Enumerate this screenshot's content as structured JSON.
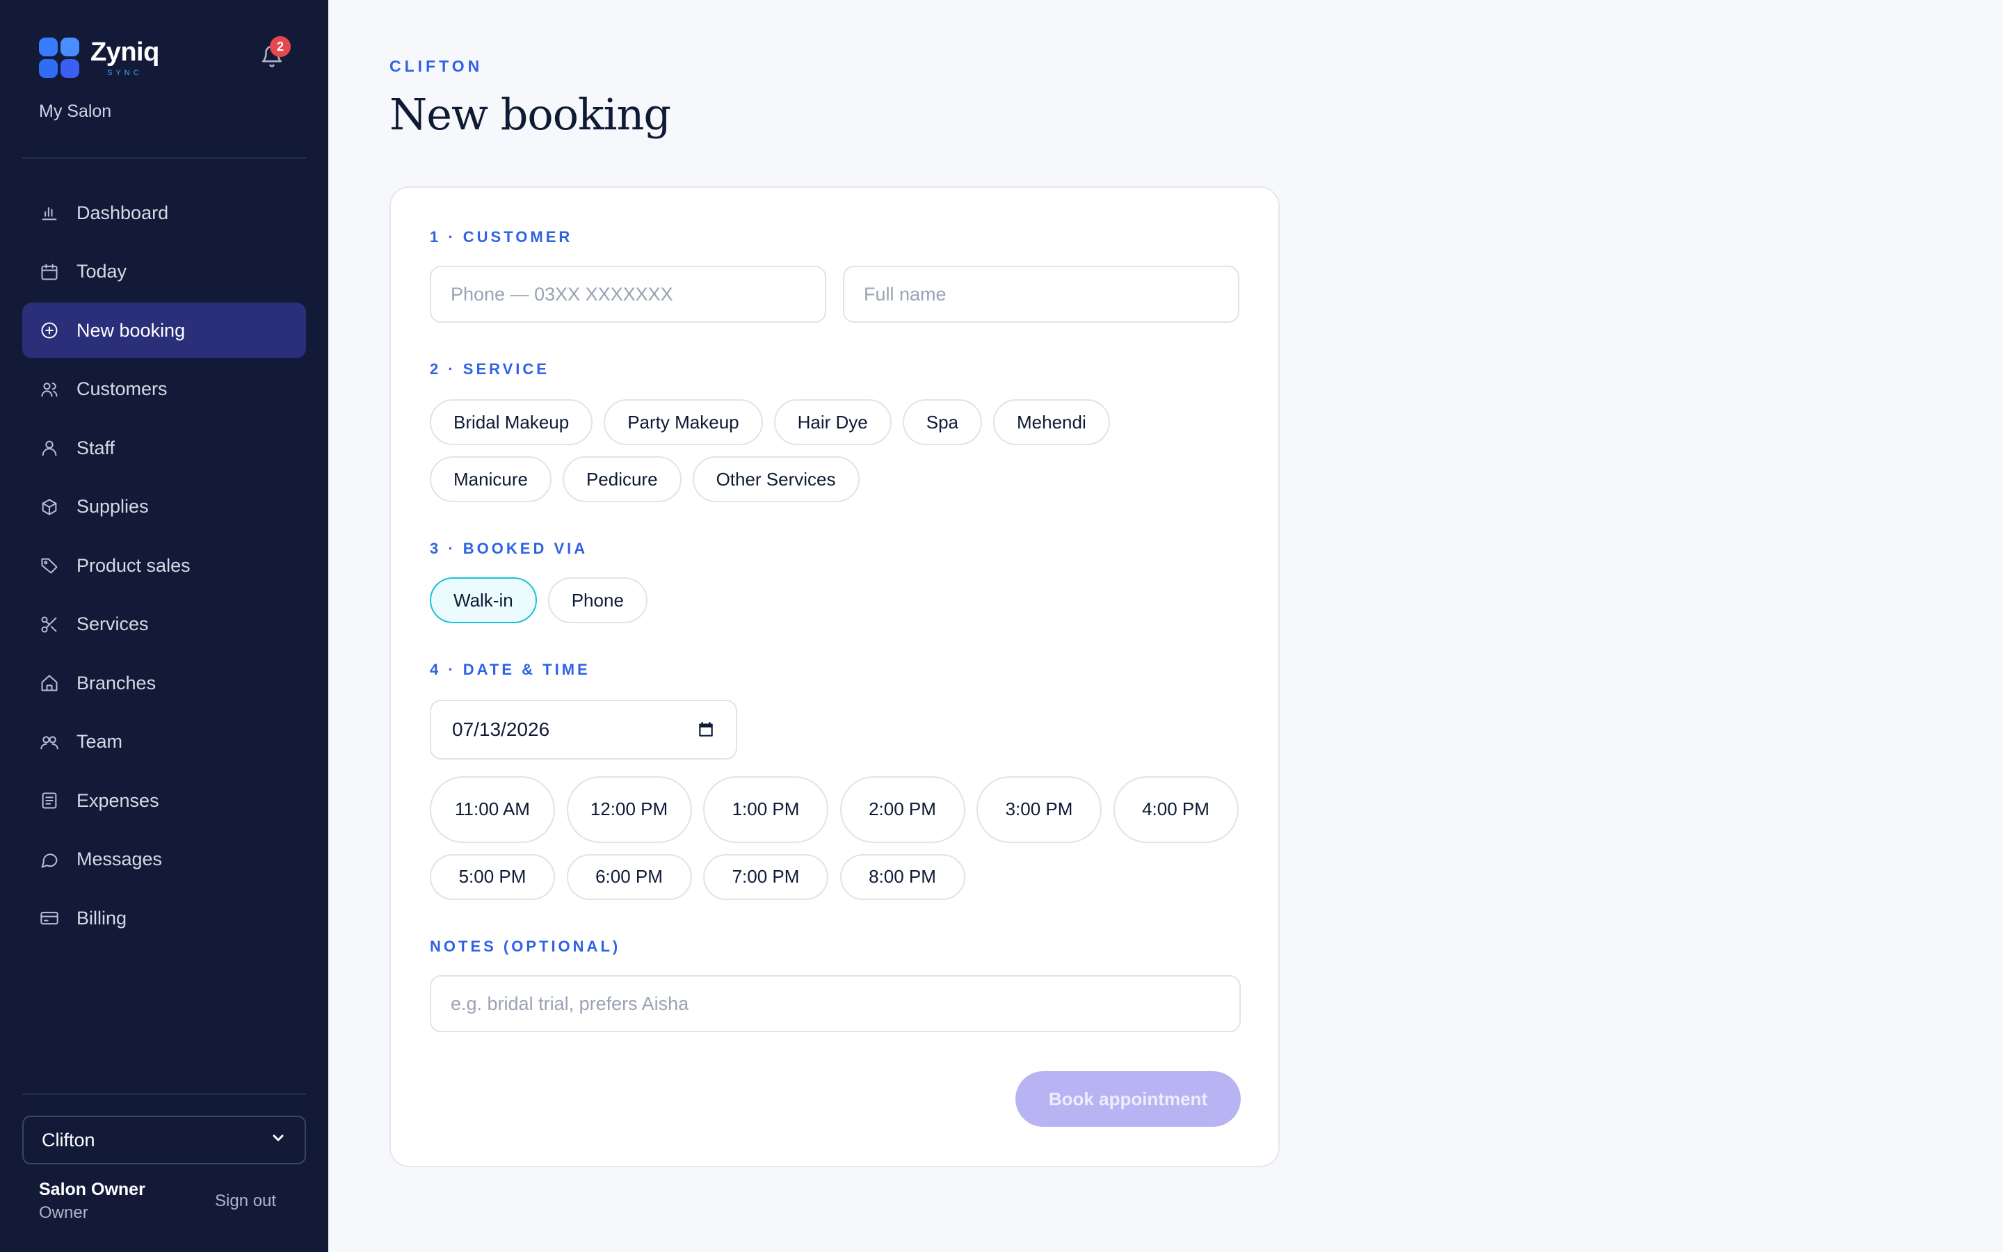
{
  "brand": {
    "name": "Zyniq",
    "sub": "SYNC",
    "salon": "My Salon",
    "notification_count": "2"
  },
  "nav": [
    {
      "label": "Dashboard",
      "icon": "bar-chart-icon",
      "active": false
    },
    {
      "label": "Today",
      "icon": "calendar-icon",
      "active": false
    },
    {
      "label": "New booking",
      "icon": "plus-circle-icon",
      "active": true
    },
    {
      "label": "Customers",
      "icon": "users-icon",
      "active": false
    },
    {
      "label": "Staff",
      "icon": "user-icon",
      "active": false
    },
    {
      "label": "Supplies",
      "icon": "box-icon",
      "active": false
    },
    {
      "label": "Product sales",
      "icon": "tag-icon",
      "active": false
    },
    {
      "label": "Services",
      "icon": "scissors-icon",
      "active": false
    },
    {
      "label": "Branches",
      "icon": "home-icon",
      "active": false
    },
    {
      "label": "Team",
      "icon": "team-icon",
      "active": false
    },
    {
      "label": "Expenses",
      "icon": "receipt-icon",
      "active": false
    },
    {
      "label": "Messages",
      "icon": "chat-icon",
      "active": false
    },
    {
      "label": "Billing",
      "icon": "credit-card-icon",
      "active": false
    }
  ],
  "branch_select": {
    "value": "Clifton"
  },
  "user": {
    "name": "Salon Owner",
    "role": "Owner",
    "signout": "Sign out"
  },
  "page": {
    "eyebrow": "CLIFTON",
    "title": "New booking"
  },
  "customer": {
    "label": "1 · CUSTOMER",
    "phone_placeholder": "Phone — 03XX XXXXXXX",
    "name_placeholder": "Full name"
  },
  "service": {
    "label": "2 · SERVICE",
    "options": [
      "Bridal Makeup",
      "Party Makeup",
      "Hair Dye",
      "Spa",
      "Mehendi",
      "Manicure",
      "Pedicure",
      "Other Services"
    ]
  },
  "booked_via": {
    "label": "3 · BOOKED VIA",
    "options": [
      "Walk-in",
      "Phone"
    ],
    "selected": "Walk-in"
  },
  "datetime": {
    "label": "4 · DATE & TIME",
    "date": "07/13/2026",
    "slots": [
      "11:00 AM",
      "12:00 PM",
      "1:00 PM",
      "2:00 PM",
      "3:00 PM",
      "4:00 PM",
      "5:00 PM",
      "6:00 PM",
      "7:00 PM",
      "8:00 PM"
    ]
  },
  "notes": {
    "label": "NOTES (OPTIONAL)",
    "placeholder": "e.g. bridal trial, prefers Aisha"
  },
  "submit": {
    "label": "Book appointment",
    "color": "#b8b4f3"
  },
  "colors": {
    "sidebar": "#121a38",
    "accent": "#2f63e4",
    "active_nav": "#2b2f7a",
    "selected_pill": "#19c3d6"
  }
}
